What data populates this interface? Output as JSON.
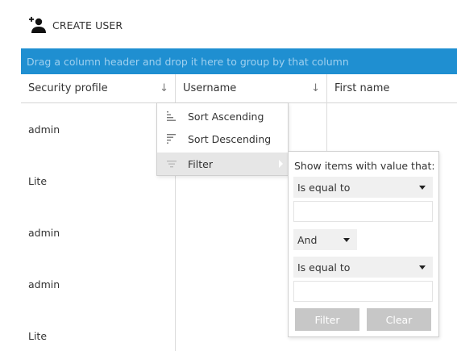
{
  "toolbar": {
    "create_user_label": "CREATE USER"
  },
  "group_panel": {
    "text": "Drag a column header and drop it here to group by that column"
  },
  "columns": [
    {
      "label": "Security profile",
      "sort_icon": "down-arrow-icon"
    },
    {
      "label": "Username",
      "sort_icon": "down-arrow-icon"
    },
    {
      "label": "First name"
    }
  ],
  "rows": [
    {
      "security_profile": "admin"
    },
    {
      "security_profile": "Lite"
    },
    {
      "security_profile": "admin"
    },
    {
      "security_profile": "admin"
    },
    {
      "security_profile": "Lite"
    }
  ],
  "column_menu": {
    "items": [
      {
        "label": "Sort Ascending",
        "icon": "sort-ascending-icon"
      },
      {
        "label": "Sort Descending",
        "icon": "sort-descending-icon"
      },
      {
        "label": "Filter",
        "icon": "filter-icon"
      }
    ],
    "hovered_item": "Filter"
  },
  "filter_popup": {
    "title": "Show items with value that:",
    "operator1": "Is equal to",
    "value1": "",
    "logic": "And",
    "operator2": "Is equal to",
    "value2": "",
    "filter_button": "Filter",
    "clear_button": "Clear"
  },
  "colors": {
    "group_panel_bg": "#1f8fd1",
    "group_panel_text": "#9fd0ef",
    "menu_hover": "#e6e6e6",
    "disabled_button": "#c7c7c7"
  }
}
